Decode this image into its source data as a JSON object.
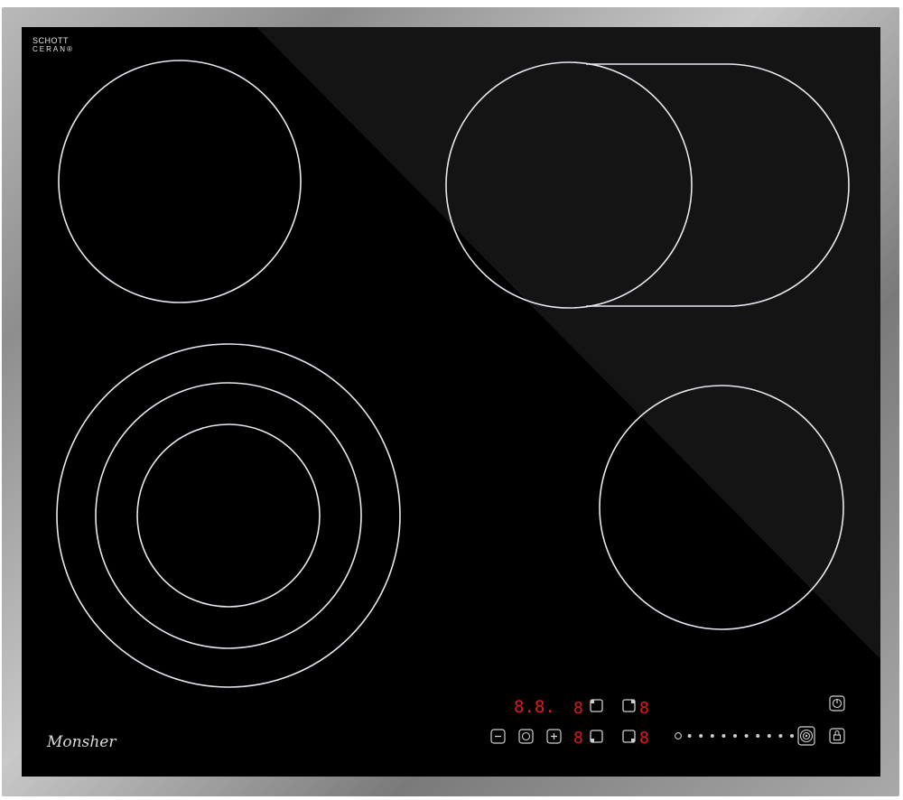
{
  "cooktop": {
    "surface_logo_line1": "SCHOTT",
    "surface_logo_line2": "CERAN®",
    "brand": "Monsher",
    "colors": {
      "glass": "#000000",
      "ring": "#e8e8f0",
      "display": "#e01a1a",
      "control": "#cfcfcf"
    },
    "timer_display": "8.8.",
    "zone_displays": [
      "8",
      "8",
      "8",
      "8",
      "8",
      "8",
      "8",
      "8"
    ],
    "power_level_dots": 11
  }
}
